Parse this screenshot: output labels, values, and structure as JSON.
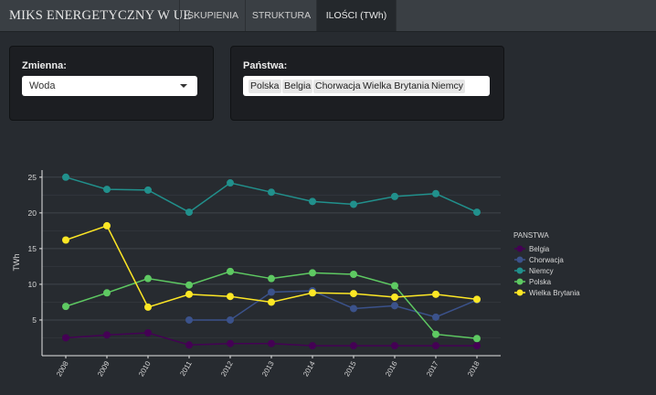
{
  "navbar": {
    "brand": "MIKS ENERGETYCZNY W UE",
    "tabs": [
      {
        "label": "SKUPIENIA",
        "active": false
      },
      {
        "label": "STRUKTURA",
        "active": false
      },
      {
        "label": "ILOŚCI (TWh)",
        "active": true
      }
    ]
  },
  "variable_panel": {
    "label": "Zmienna:",
    "selected": "Woda"
  },
  "countries_panel": {
    "label": "Państwa:",
    "selected": [
      "Polska",
      "Belgia",
      "Chorwacja",
      "Wielka Brytania",
      "Niemcy"
    ]
  },
  "chart_data": {
    "type": "line",
    "ylabel": "TWh",
    "xlabel": "",
    "x": [
      2008,
      2009,
      2010,
      2011,
      2012,
      2013,
      2014,
      2015,
      2016,
      2017,
      2018
    ],
    "ylim": [
      0,
      26
    ],
    "yticks": [
      5,
      10,
      15,
      20,
      25
    ],
    "legend_title": "PANSTWA",
    "legend_position": "right",
    "grid": true,
    "series": [
      {
        "name": "Belgia",
        "color": "#440154",
        "values": [
          2.5,
          2.9,
          3.2,
          1.5,
          1.7,
          1.7,
          1.4,
          1.4,
          1.4,
          1.4,
          1.4
        ]
      },
      {
        "name": "Chorwacja",
        "color": "#3b528b",
        "values": [
          null,
          null,
          null,
          5.0,
          5.0,
          8.9,
          9.1,
          6.6,
          7.0,
          5.4,
          7.8
        ]
      },
      {
        "name": "Niemcy",
        "color": "#21908c",
        "values": [
          25.0,
          23.3,
          23.2,
          20.1,
          24.2,
          22.9,
          21.6,
          21.2,
          22.3,
          22.7,
          20.1
        ]
      },
      {
        "name": "Polska",
        "color": "#5ec962",
        "values": [
          6.9,
          8.8,
          10.8,
          9.9,
          11.8,
          10.8,
          11.6,
          11.4,
          9.8,
          3.0,
          2.4
        ]
      },
      {
        "name": "Wielka Brytania",
        "color": "#fde725",
        "values": [
          16.2,
          18.2,
          6.8,
          8.6,
          8.3,
          7.5,
          8.8,
          8.7,
          8.2,
          8.6,
          7.9
        ]
      }
    ]
  }
}
